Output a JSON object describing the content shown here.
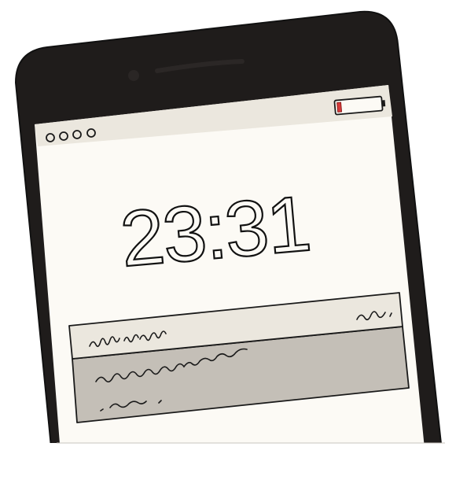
{
  "lock_screen": {
    "time": "23:31",
    "notification_dots": 4,
    "battery_level": 0.08,
    "notification": {
      "header_scribble_left": "handwritten-scribble",
      "header_scribble_right": "handwritten-scribble",
      "body_scribble_line_1": "handwritten-scribble",
      "body_scribble_line_2": "handwritten-scribble"
    }
  },
  "icons": {
    "battery": "battery-low-icon",
    "dots": "status-dots-icon",
    "speaker": "speaker-slot-icon",
    "camera": "front-camera-icon"
  },
  "colors": {
    "phone_body": "#1f1c1b",
    "screen_bg": "#fcfaf5",
    "status_bar": "#ebe7de",
    "notification_header": "#ebe7de",
    "notification_body": "#c4bfb7",
    "battery_red": "#d63a3a",
    "ink": "#1a1a1a"
  }
}
